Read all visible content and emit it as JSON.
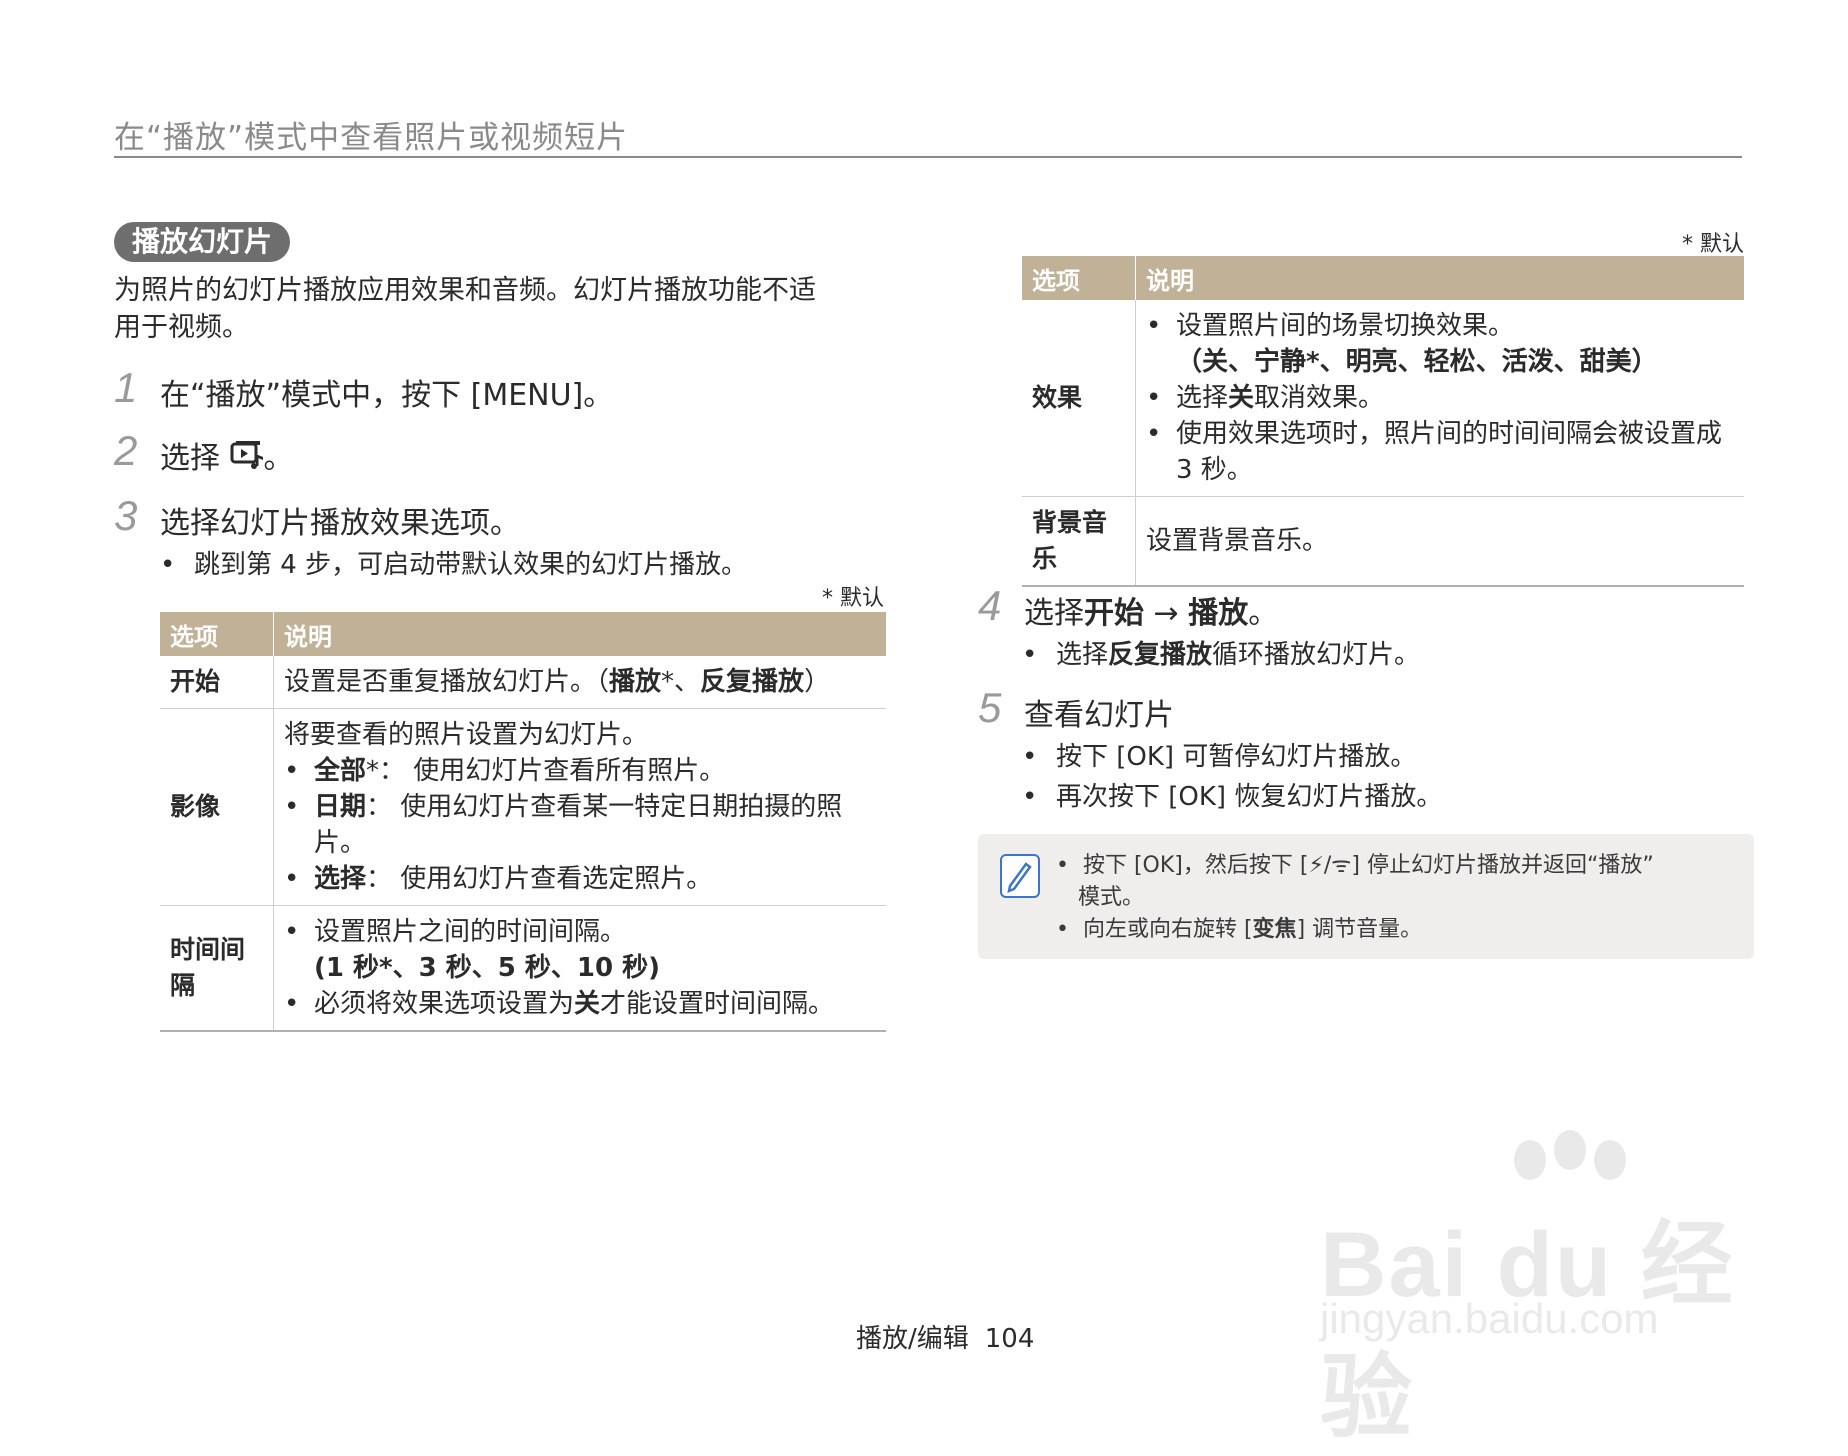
{
  "header": {
    "title": "在“播放”模式中查看照片或视频短片"
  },
  "section": {
    "pill": "播放幻灯片",
    "intro_line1": "为照片的幻灯片播放应用效果和音频。幻灯片播放功能不适",
    "intro_line2": "用于视频。"
  },
  "steps": [
    {
      "num": "1",
      "text": "在“播放”模式中，按下 [MENU]。"
    },
    {
      "num": "2",
      "text": "选择 ",
      "icon": "slideshow-music-icon",
      "suffix": "。"
    },
    {
      "num": "3",
      "text": "选择幻灯片播放效果选项。",
      "bullet": "跳到第 4 步，可启动带默认效果的幻灯片播放。"
    },
    {
      "num": "4",
      "text_a": "选择",
      "text_b": "开始",
      "text_c": " → ",
      "text_d": "播放",
      "text_e": "。",
      "bullet_a": "选择",
      "bullet_b": "反复播放",
      "bullet_c": "循环播放幻灯片。"
    },
    {
      "num": "5",
      "text": "查看幻灯片",
      "bullets": [
        "按下 [OK] 可暂停幻灯片播放。",
        "再次按下 [OK] 恢复幻灯片播放。"
      ]
    }
  ],
  "default_note": "* 默认",
  "table_left": {
    "header": [
      "选项",
      "说明"
    ],
    "start": {
      "label": "开始",
      "text_a": "设置是否重复播放幻灯片。（",
      "text_b": "播放",
      "text_c": "*、",
      "text_d": "反复播放",
      "text_e": "）"
    },
    "image": {
      "label": "影像",
      "line1": "将要查看的照片设置为幻灯片。",
      "b1_bold": "全部",
      "b1_rest": "*： 使用幻灯片查看所有照片。",
      "b2_bold": "日期",
      "b2_rest": "： 使用幻灯片查看某一特定日期拍摄的照片。",
      "b3_bold": "选择",
      "b3_rest": "： 使用幻灯片查看选定照片。"
    },
    "interval": {
      "label": "时间间隔",
      "b1": "设置照片之间的时间间隔。",
      "b1_sub": "(1 秒*、3 秒、5 秒、10 秒)",
      "b2_a": "必须将效果选项设置为",
      "b2_b": "关",
      "b2_c": "才能设置时间间隔。"
    }
  },
  "table_right": {
    "header": [
      "选项",
      "说明"
    ],
    "effect": {
      "label": "效果",
      "b1": "设置照片间的场景切换效果。",
      "b1_sub": "（关、宁静*、明亮、轻松、活泼、甜美）",
      "b2_a": "选择",
      "b2_b": "关",
      "b2_c": "取消效果。",
      "b3": "使用效果选项时，照片间的时间间隔会被设置成 3 秒。"
    },
    "music": {
      "label": "背景音乐",
      "text": "设置背景音乐。"
    }
  },
  "note": {
    "icon": "note-pencil-icon",
    "line1": "按下 [OK]，然后按下 [⚡/ᯤ] 停止幻灯片播放并返回“播放”",
    "line1b": "模式。",
    "line2_a": "向左或向右旋转 [",
    "line2_b": "变焦",
    "line2_c": "] 调节音量。"
  },
  "footer": {
    "section": "播放/编辑",
    "page": "104"
  },
  "watermark": {
    "brand": "Bai du 经验",
    "url": "jingyan.baidu.com"
  }
}
